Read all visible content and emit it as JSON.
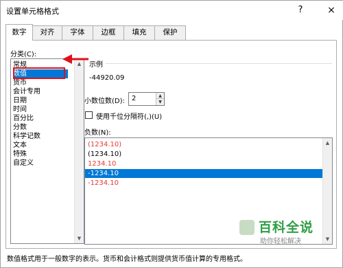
{
  "window": {
    "title": "设置单元格格式",
    "help_glyph": "?",
    "close_glyph": "×"
  },
  "tabs": [
    {
      "label": "数字",
      "active": true
    },
    {
      "label": "对齐",
      "active": false
    },
    {
      "label": "字体",
      "active": false
    },
    {
      "label": "边框",
      "active": false
    },
    {
      "label": "填充",
      "active": false
    },
    {
      "label": "保护",
      "active": false
    }
  ],
  "category": {
    "label": "分类(C):",
    "items": [
      "常规",
      "数值",
      "货币",
      "会计专用",
      "日期",
      "时间",
      "百分比",
      "分数",
      "科学记数",
      "文本",
      "特殊",
      "自定义"
    ],
    "selected_index": 1
  },
  "sample": {
    "label": "示例",
    "value": "-44920.09"
  },
  "decimal_places": {
    "label": "小数位数(D):",
    "value": "2"
  },
  "thousands_separator": {
    "label": "使用千位分隔符(,)(U)",
    "checked": false
  },
  "negative_numbers": {
    "label": "负数(N):",
    "items": [
      {
        "text": "(1234.10)",
        "color": "#e53935"
      },
      {
        "text": "(1234.10)",
        "color": "#000000"
      },
      {
        "text": "1234.10",
        "color": "#e53935"
      },
      {
        "text": "-1234.10",
        "color": "#ffffff"
      },
      {
        "text": "-1234.10",
        "color": "#e53935"
      }
    ],
    "selected_index": 3
  },
  "watermark": {
    "main": "百科全说",
    "sub": "助你轻松解决"
  },
  "description": "数值格式用于一般数字的表示。货币和会计格式则提供货币值计算的专用格式。",
  "colors": {
    "selection": "#0078d7",
    "highlight_box": "#e0101a",
    "negative_red": "#e53935"
  }
}
